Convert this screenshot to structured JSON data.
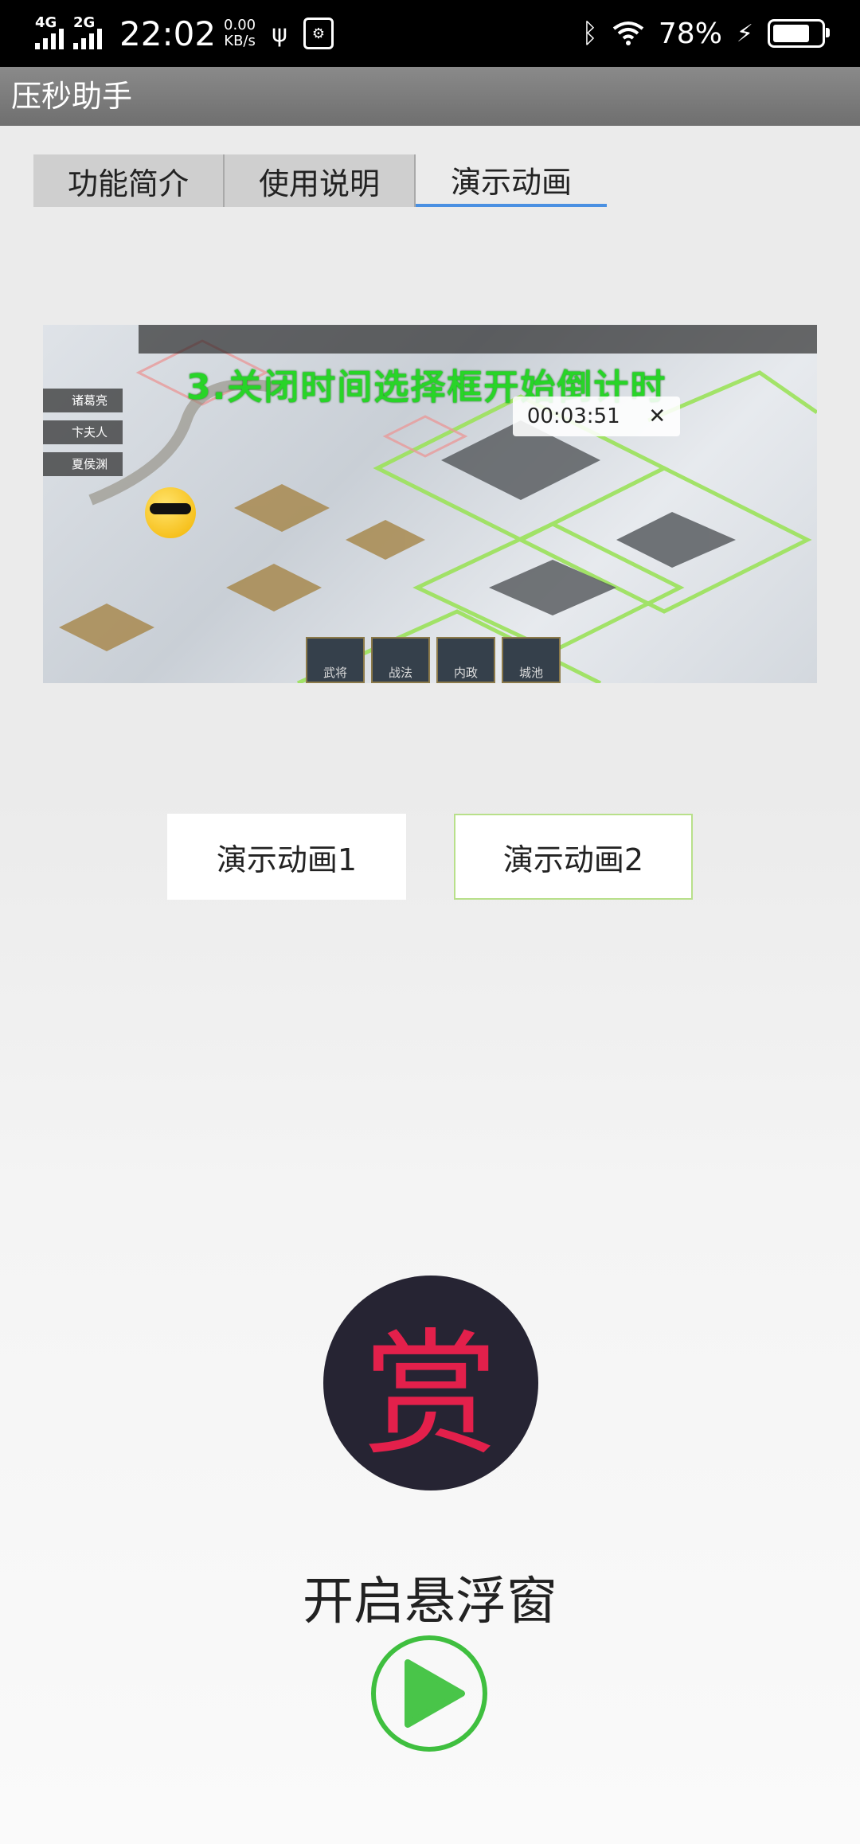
{
  "status_bar": {
    "signal1": "4G",
    "signal2": "2G",
    "time": "22:02",
    "speed_value": "0.00",
    "speed_unit": "KB/s",
    "battery": "78%",
    "battery_level": 0.78
  },
  "app": {
    "title": "压秒助手"
  },
  "tabs": [
    {
      "label": "功能简介",
      "active": false
    },
    {
      "label": "使用说明",
      "active": false
    },
    {
      "label": "演示动画",
      "active": true
    }
  ],
  "preview": {
    "caption": "3.关闭时间选择框开始倒计时",
    "timer_value": "00:03:51",
    "timer_close": "✕",
    "side_items": [
      "诸葛亮",
      "卞夫人",
      "夏侯渊"
    ],
    "bottom_items": [
      "武将",
      "战法",
      "内政",
      "城池"
    ]
  },
  "buttons": {
    "demo1": "演示动画1",
    "demo2": "演示动画2"
  },
  "reward": {
    "glyph": "赏"
  },
  "float_window": {
    "label": "开启悬浮窗"
  },
  "colors": {
    "accent_tab": "#4a90e2",
    "reward_bg": "#262433",
    "reward_text": "#e3204b",
    "play_green": "#3fbf3f"
  }
}
